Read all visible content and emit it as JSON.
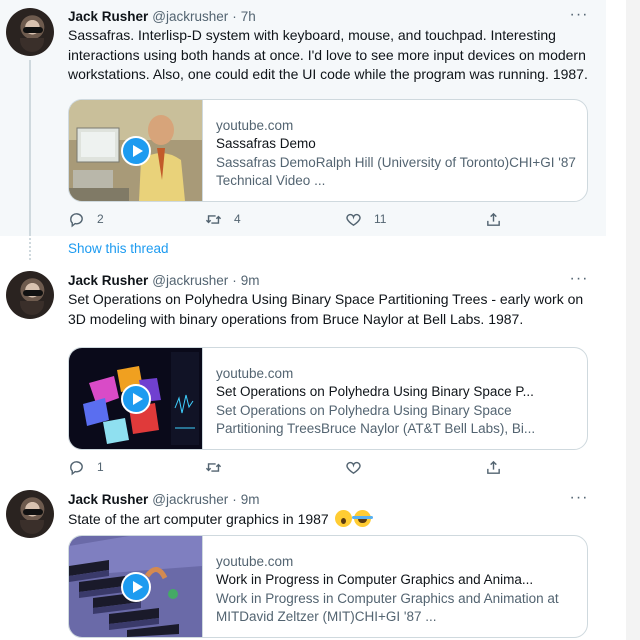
{
  "tweets": [
    {
      "name": "Jack Rusher",
      "handle": "@jackrusher",
      "time": "7h",
      "more": "···",
      "text": "Sassafras. Interlisp-D system with keyboard, mouse, and touchpad. Interesting interactions using both hands at once. I'd love to see more input devices on modern workstations. Also, one could edit the UI code while the program was running. 1987.",
      "card": {
        "domain": "youtube.com",
        "title": "Sassafras Demo",
        "description": "Sassafras DemoRalph Hill (University of Toronto)CHI+GI '87 Technical Video ..."
      },
      "counts": {
        "reply": "2",
        "retweet": "4",
        "like": "11"
      }
    },
    {
      "name": "Jack Rusher",
      "handle": "@jackrusher",
      "time": "9m",
      "more": "···",
      "text": "Set Operations on Polyhedra Using Binary Space Partitioning Trees - early work on 3D modeling with binary operations from Bruce Naylor at Bell Labs. 1987.",
      "card": {
        "domain": "youtube.com",
        "title": "Set Operations on Polyhedra Using Binary Space P...",
        "description": "Set Operations on Polyhedra Using Binary Space Partitioning TreesBruce Naylor (AT&T Bell Labs), Bi..."
      },
      "counts": {
        "reply": "1",
        "retweet": "",
        "like": ""
      }
    },
    {
      "name": "Jack Rusher",
      "handle": "@jackrusher",
      "time": "9m",
      "more": "···",
      "text": "State of the art computer graphics in 1987",
      "card": {
        "domain": "youtube.com",
        "title": "Work in Progress in Computer Graphics and Anima...",
        "description": "Work in Progress in Computer Graphics and Animation at MITDavid Zeltzer (MIT)CHI+GI '87 ..."
      }
    }
  ],
  "show_thread": "Show this thread",
  "colors": {
    "accent": "#1d9bf0",
    "muted": "#536471",
    "border": "#cfd9de",
    "highlight_bg": "#f5f8fa"
  },
  "icons": [
    "reply-icon",
    "retweet-icon",
    "like-icon",
    "share-icon",
    "play-icon",
    "more-icon",
    "face-screaming-emoji",
    "face-tears-of-joy-emoji"
  ]
}
